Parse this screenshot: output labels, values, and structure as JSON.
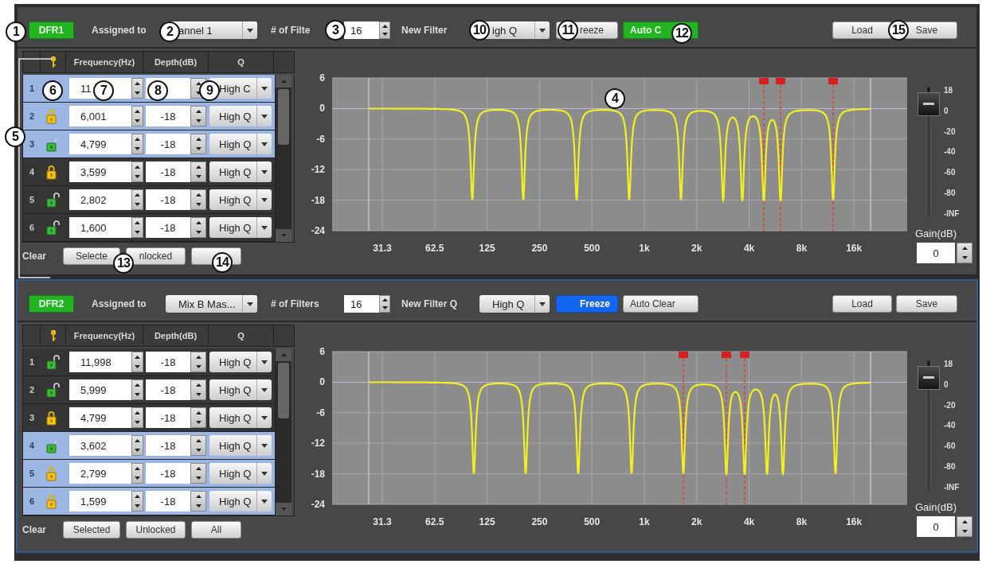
{
  "callouts": [
    "1",
    "2",
    "3",
    "4",
    "5",
    "6",
    "7",
    "8",
    "9",
    "10",
    "11",
    "12",
    "13",
    "14",
    "15"
  ],
  "panels": [
    {
      "badge": {
        "label": "DFR1",
        "on": true
      },
      "assigned_label": "Assigned to",
      "channel": "annel 1",
      "filters_label": "# of Filte",
      "filters_value": "16",
      "new_q_label": "New Filter",
      "new_q_value": "igh Q",
      "freeze": {
        "label": "reeze",
        "on": false
      },
      "auto_clear": {
        "label": "Auto C",
        "on": true
      },
      "load": "Load",
      "save": "Save",
      "columns": [
        "Frequency(Hz)",
        "Depth(dB)",
        "Q"
      ],
      "rows": [
        {
          "number": "1",
          "selected": true,
          "frequency": "11",
          "q": "High C"
        },
        {
          "number": "2",
          "selected": true,
          "kind": "locked",
          "frequency": "6,001",
          "depth": "-18",
          "q": "High Q"
        },
        {
          "number": "3",
          "selected": true,
          "kind": "auto",
          "frequency": "4,799",
          "depth": "-18",
          "q": "High Q"
        },
        {
          "number": "4",
          "selected": false,
          "kind": "locked",
          "frequency": "3,599",
          "depth": "-18",
          "q": "High Q"
        },
        {
          "number": "5",
          "selected": false,
          "kind": "unlocked",
          "frequency": "2,802",
          "depth": "-18",
          "q": "High Q"
        },
        {
          "number": "6",
          "selected": false,
          "kind": "unlocked",
          "frequency": "1,600",
          "depth": "-18",
          "q": "High Q"
        }
      ],
      "clear_label": "Clear",
      "clear_buttons": [
        {
          "kind": "labeled",
          "label": "Selecte"
        },
        {
          "kind": "labeled",
          "label": "nlocked"
        },
        {
          "kind": "blank"
        }
      ],
      "chart": {
        "y_ticks": [
          "6",
          "0",
          "-6",
          "-12",
          "-18",
          "-24"
        ],
        "x_ticks": [
          "31.3",
          "62.5",
          "125",
          "250",
          "500",
          "1k",
          "2k",
          "4k",
          "8k",
          "16k"
        ]
      },
      "gain": {
        "scale": [
          "18",
          "0",
          "-20",
          "-40",
          "-60",
          "-80",
          "-INF"
        ],
        "label": "Gain(dB)",
        "value": "0",
        "level": 0.87
      }
    },
    {
      "badge": {
        "label": "DFR2",
        "on": true
      },
      "assigned_label": "Assigned to",
      "channel": "Mix B Mas...",
      "filters_label": "# of Filters",
      "filters_value": "16",
      "new_q_label": "New Filter Q",
      "new_q_value": "High Q",
      "freeze": {
        "label": "Freeze",
        "on": true
      },
      "auto_clear": {
        "label": "Auto Clear",
        "on": false
      },
      "load": "Load",
      "save": "Save",
      "columns": [
        "Frequency(Hz)",
        "Depth(dB)",
        "Q"
      ],
      "rows": [
        {
          "number": "1",
          "selected": false,
          "kind": "unlocked",
          "frequency": "11,998",
          "depth": "-18",
          "q": "High Q"
        },
        {
          "number": "2",
          "selected": false,
          "kind": "unlocked",
          "frequency": "5,999",
          "depth": "-18",
          "q": "High Q"
        },
        {
          "number": "3",
          "selected": false,
          "kind": "locked",
          "frequency": "4,799",
          "depth": "-18",
          "q": "High Q"
        },
        {
          "number": "4",
          "selected": true,
          "kind": "auto",
          "frequency": "3,602",
          "depth": "-18",
          "q": "High Q"
        },
        {
          "number": "5",
          "selected": true,
          "kind": "locked",
          "frequency": "2,799",
          "depth": "-18",
          "q": "High Q"
        },
        {
          "number": "6",
          "selected": true,
          "kind": "locked",
          "frequency": "1,599",
          "depth": "-18",
          "q": "High Q"
        }
      ],
      "clear_label": "Clear",
      "clear_buttons": [
        {
          "kind": "labeled",
          "label": "Selected"
        },
        {
          "kind": "labeled",
          "label": "Unlocked"
        },
        {
          "kind": "labeled",
          "label": "All"
        }
      ],
      "chart": {
        "y_ticks": [
          "6",
          "0",
          "-6",
          "-12",
          "-18",
          "-24"
        ],
        "x_ticks": [
          "31.3",
          "62.5",
          "125",
          "250",
          "500",
          "1k",
          "2k",
          "4k",
          "8k",
          "16k"
        ]
      },
      "gain": {
        "scale": [
          "18",
          "0",
          "-20",
          "-40",
          "-60",
          "-80",
          "-INF"
        ],
        "label": "Gain(dB)",
        "value": "0",
        "level": 0.87
      }
    }
  ]
}
